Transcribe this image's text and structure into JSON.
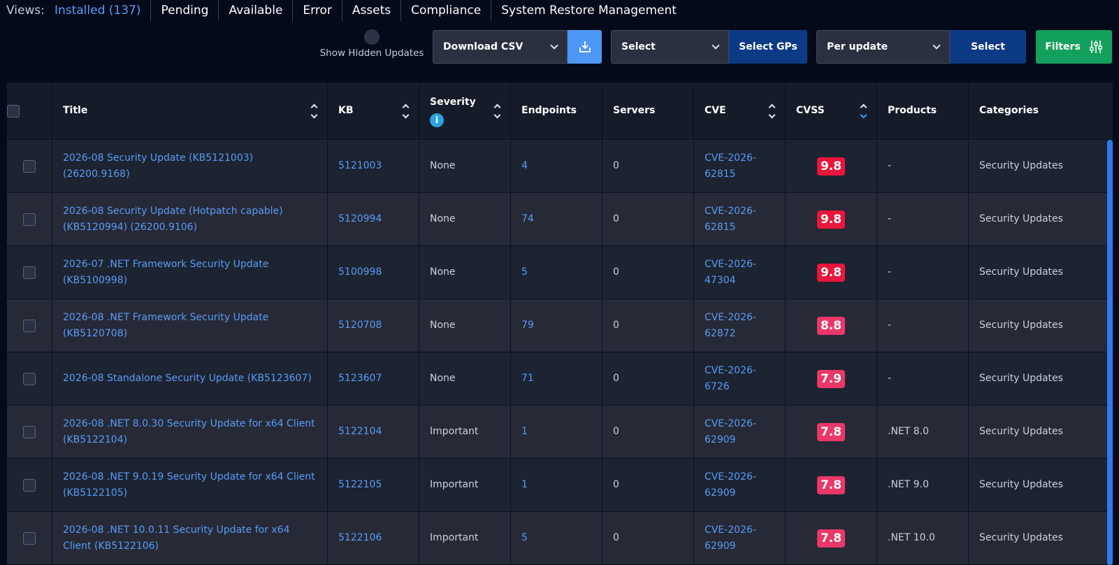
{
  "views": {
    "label": "Views:",
    "items": [
      {
        "label": "Installed (137)"
      },
      {
        "label": "Pending"
      },
      {
        "label": "Available"
      },
      {
        "label": "Error"
      },
      {
        "label": "Assets"
      },
      {
        "label": "Compliance"
      },
      {
        "label": "System Restore Management"
      }
    ]
  },
  "toolbar": {
    "show_hidden_label": "Show Hidden Updates",
    "download_select": "Download CSV",
    "group_select": "Select",
    "select_gps_label": "Select GPs",
    "per_update_select": "Per update",
    "select_label": "Select",
    "filters_label": "Filters"
  },
  "table": {
    "headers": [
      "Title",
      "KB",
      "Severity",
      "Endpoints",
      "Servers",
      "CVE",
      "CVSS",
      "Products",
      "Categories"
    ],
    "rows": [
      {
        "title": "2026-08 Security Update (KB5121003) (26200.9168)",
        "kb": "5121003",
        "severity": "None",
        "endpoints": "4",
        "servers": "0",
        "cve1": "CVE-2026-",
        "cve2": "62815",
        "cvss": "9.8",
        "products": "-",
        "categories": "Security Updates"
      },
      {
        "title": "2026-08 Security Update (Hotpatch capable) (KB5120994) (26200.9106)",
        "kb": "5120994",
        "severity": "None",
        "endpoints": "74",
        "servers": "0",
        "cve1": "CVE-2026-",
        "cve2": "62815",
        "cvss": "9.8",
        "products": "-",
        "categories": "Security Updates"
      },
      {
        "title": "2026-07 .NET Framework Security Update (KB5100998)",
        "kb": "5100998",
        "severity": "None",
        "endpoints": "5",
        "servers": "0",
        "cve1": "CVE-2026-",
        "cve2": "47304",
        "cvss": "9.8",
        "products": "-",
        "categories": "Security Updates"
      },
      {
        "title": "2026-08 .NET Framework Security Update (KB5120708)",
        "kb": "5120708",
        "severity": "None",
        "endpoints": "79",
        "servers": "0",
        "cve1": "CVE-2026-",
        "cve2": "62872",
        "cvss": "8.8",
        "products": "-",
        "categories": "Security Updates"
      },
      {
        "title": "2026-08 Standalone Security Update (KB5123607)",
        "kb": "5123607",
        "severity": "None",
        "endpoints": "71",
        "servers": "0",
        "cve1": "CVE-2026-",
        "cve2": "6726",
        "cvss": "7.9",
        "products": "-",
        "categories": "Security Updates"
      },
      {
        "title": "2026-08 .NET 8.0.30 Security Update for x64 Client (KB5122104)",
        "kb": "5122104",
        "severity": "Important",
        "endpoints": "1",
        "servers": "0",
        "cve1": "CVE-2026-",
        "cve2": "62909",
        "cvss": "7.8",
        "products": ".NET 8.0",
        "categories": "Security Updates"
      },
      {
        "title": "2026-08 .NET 9.0.19 Security Update for x64 Client (KB5122105)",
        "kb": "5122105",
        "severity": "Important",
        "endpoints": "1",
        "servers": "0",
        "cve1": "CVE-2026-",
        "cve2": "62909",
        "cvss": "7.8",
        "products": ".NET 9.0",
        "categories": "Security Updates"
      },
      {
        "title": "2026-08 .NET 10.0.11 Security Update for x64 Client (KB5122106)",
        "kb": "5122106",
        "severity": "Important",
        "endpoints": "5",
        "servers": "0",
        "cve1": "CVE-2026-",
        "cve2": "62909",
        "cvss": "7.8",
        "products": ".NET 10.0",
        "categories": "Security Updates"
      }
    ]
  },
  "colors": {
    "cvss_critical": "#e8163a",
    "cvss_high": "#ea3767",
    "link": "#5b9cf5",
    "filters_green": "#13a05c",
    "select_blue": "#0d3a84"
  },
  "icons": {
    "info": "i"
  }
}
